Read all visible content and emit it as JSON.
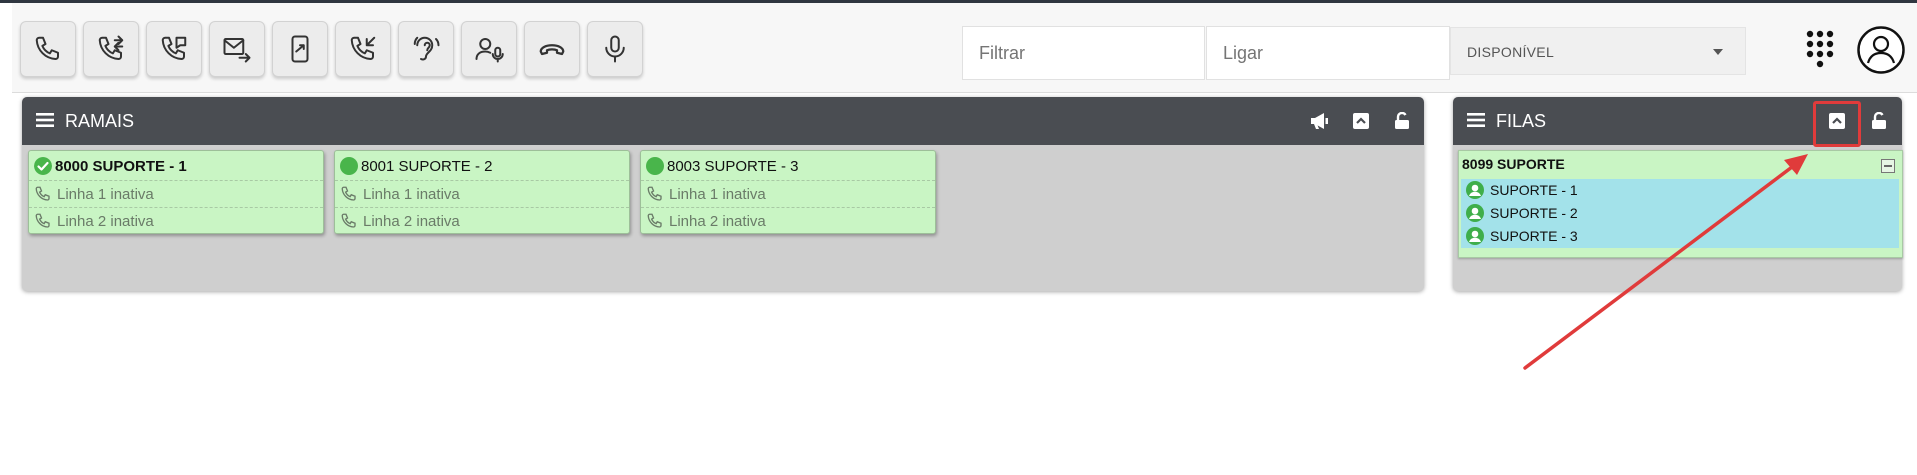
{
  "toolbar": {
    "buttons": [
      {
        "icon": "phone-icon"
      },
      {
        "icon": "phone-transfer-icon"
      },
      {
        "icon": "phone-message-icon"
      },
      {
        "icon": "mail-forward-icon"
      },
      {
        "icon": "mobile-transfer-icon"
      },
      {
        "icon": "phone-incoming-icon"
      },
      {
        "icon": "ear-listen-icon"
      },
      {
        "icon": "user-mic-icon"
      },
      {
        "icon": "hangup-icon"
      },
      {
        "icon": "microphone-icon"
      }
    ],
    "filter_placeholder": "Filtrar",
    "dial_placeholder": "Ligar",
    "status_value": "DISPONÍVEL"
  },
  "ramais_panel": {
    "title": "RAMAIS",
    "cards": [
      {
        "title": "8000 SUPORTE - 1",
        "status": "check",
        "line1": "Linha 1 inativa",
        "line2": "Linha 2 inativa"
      },
      {
        "title": "8001 SUPORTE - 2",
        "status": "online",
        "line1": "Linha 1 inativa",
        "line2": "Linha 2 inativa"
      },
      {
        "title": "8003 SUPORTE - 3",
        "status": "online",
        "line1": "Linha 1 inativa",
        "line2": "Linha 2 inativa"
      }
    ]
  },
  "filas_panel": {
    "title": "FILAS",
    "queue": {
      "title": "8099 SUPORTE",
      "agents": [
        "SUPORTE - 1",
        "SUPORTE - 2",
        "SUPORTE - 3"
      ]
    }
  },
  "colors": {
    "header_bg": "#4a4d52",
    "panel_bg": "#cfcfcf",
    "card_green": "#c9f5c4",
    "agent_cyan": "#a3e2ea",
    "status_green": "#49b54b",
    "annotation_red": "#e03b3b"
  }
}
